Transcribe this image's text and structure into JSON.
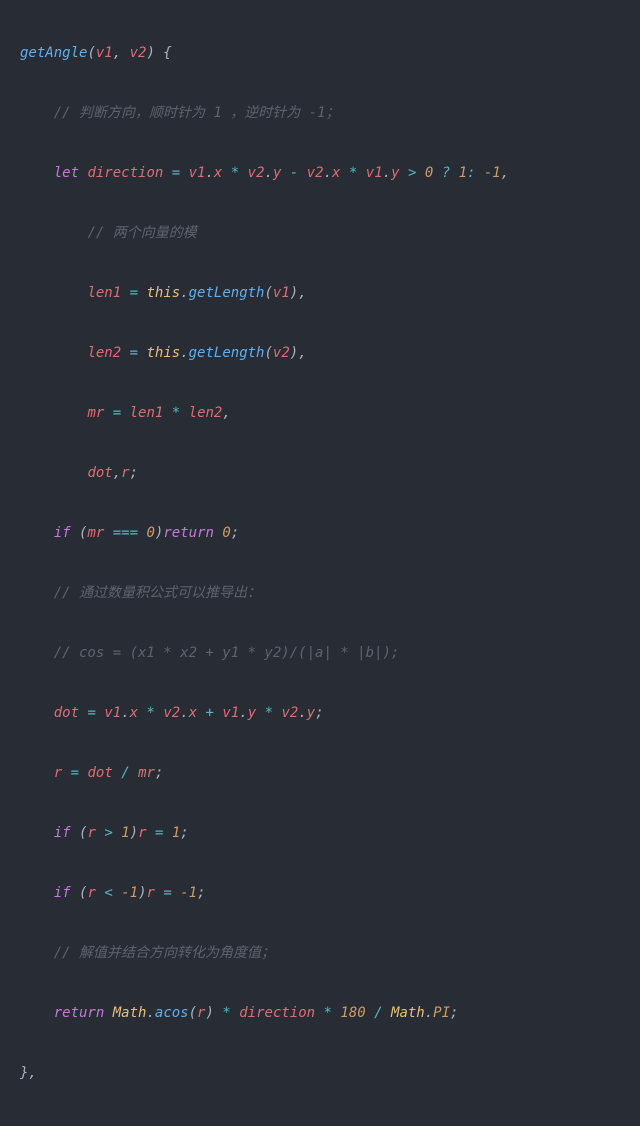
{
  "code": {
    "l1": {
      "fn": "getAngle",
      "p1": "v1",
      "p2": "v2"
    },
    "l2": {
      "cmt": "// 判断方向，顺时针为 1 ，逆时针为 -1；"
    },
    "l3": {
      "kw": "let",
      "id": "direction",
      "p1": "v1",
      "x1": "x",
      "p2": "v2",
      "y1": "y",
      "p3": "v2",
      "x2": "x",
      "p4": "v1",
      "y2": "y",
      "zero": "0",
      "one": "1",
      "neg1": "-1"
    },
    "l4": {
      "cmt": "// 两个向量的模"
    },
    "l5": {
      "id": "len1",
      "this": "this",
      "fn": "getLength",
      "arg": "v1"
    },
    "l6": {
      "id": "len2",
      "this": "this",
      "fn": "getLength",
      "arg": "v2"
    },
    "l7": {
      "id": "mr",
      "a": "len1",
      "b": "len2"
    },
    "l8": {
      "a": "dot",
      "b": "r"
    },
    "l9": {
      "kw1": "if",
      "id": "mr",
      "zero1": "0",
      "kw2": "return",
      "zero2": "0"
    },
    "l10": {
      "cmt": "// 通过数量积公式可以推导出："
    },
    "l11": {
      "cmt": "// cos = (x1 * x2 + y1 * y2)/(|a| * |b|);"
    },
    "l12": {
      "id": "dot",
      "p1": "v1",
      "x1": "x",
      "p2": "v2",
      "x2": "x",
      "p3": "v1",
      "y1": "y",
      "p4": "v2",
      "y2": "y"
    },
    "l13": {
      "id": "r",
      "a": "dot",
      "b": "mr"
    },
    "l14": {
      "kw": "if",
      "id1": "r",
      "one": "1",
      "id2": "r",
      "val": "1"
    },
    "l15": {
      "kw": "if",
      "id1": "r",
      "neg1": "-1",
      "id2": "r",
      "val": "-1"
    },
    "l16": {
      "cmt": "// 解值并结合方向转化为角度值；"
    },
    "l17": {
      "kw": "return",
      "obj": "Math",
      "fn": "acos",
      "arg": "r",
      "id": "direction",
      "n180": "180",
      "obj2": "Math",
      "pi": "PI"
    }
  }
}
